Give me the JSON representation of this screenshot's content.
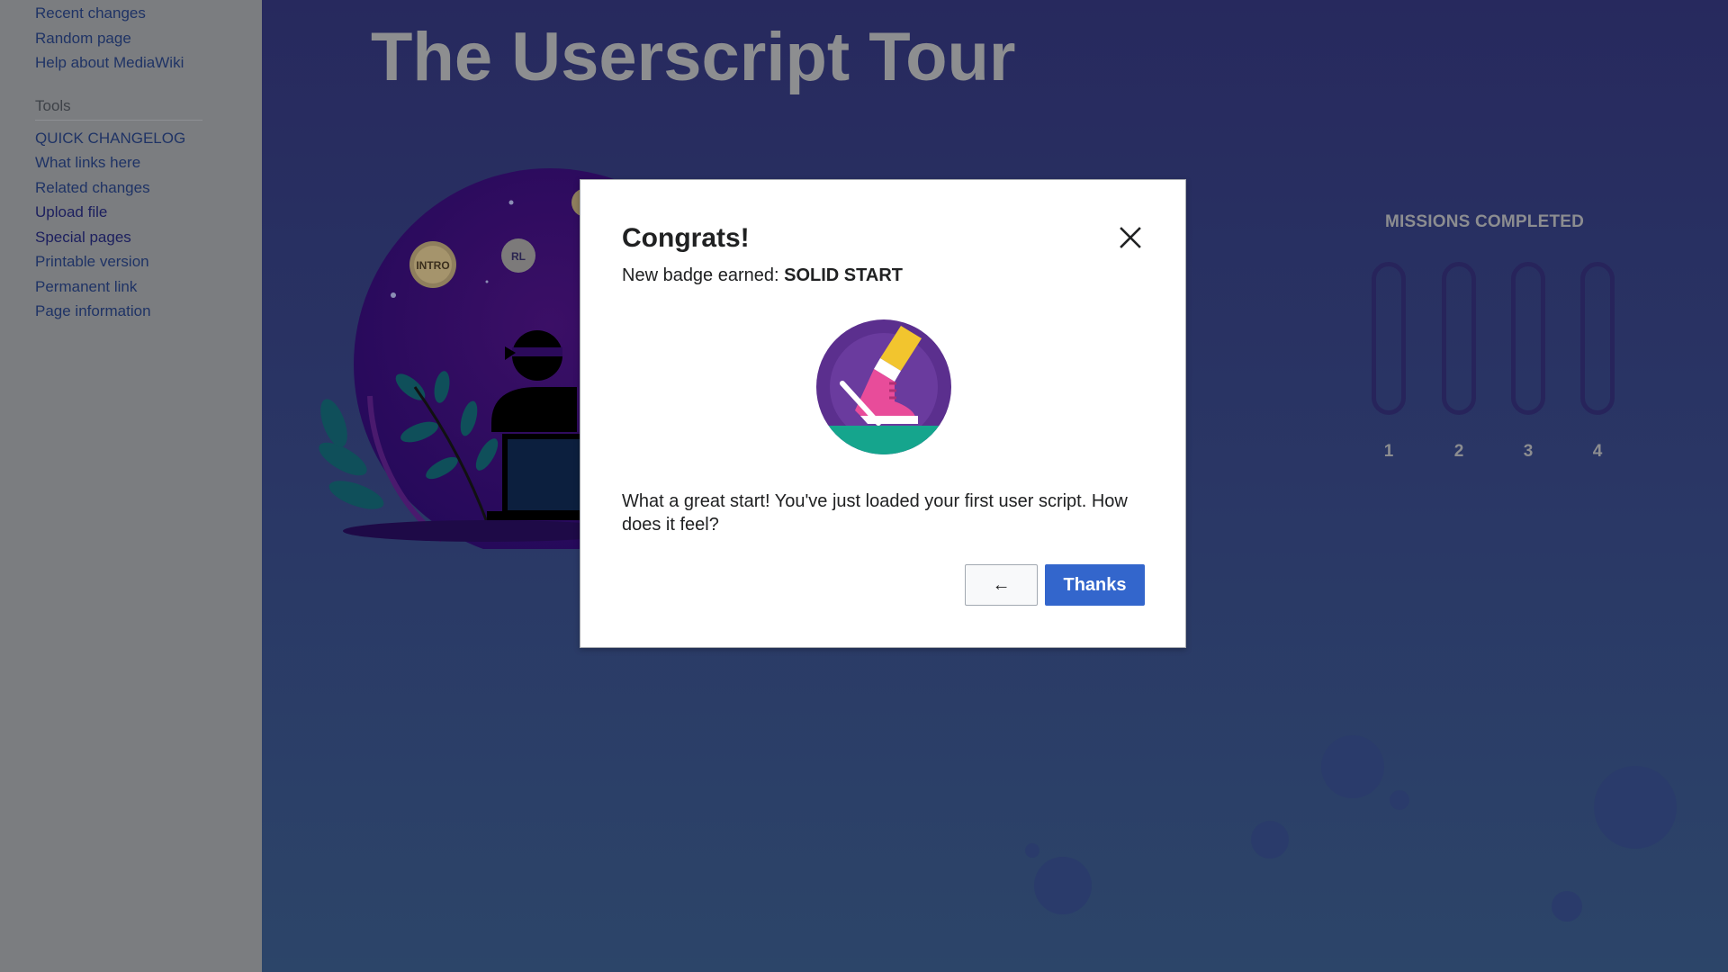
{
  "sidebar": {
    "nav_links": [
      "Recent changes",
      "Random page",
      "Help about MediaWiki"
    ],
    "tools_heading": "Tools",
    "tool_links": [
      "QUICK CHANGELOG",
      "What links here",
      "Related changes",
      "Upload file",
      "Special pages",
      "Printable version",
      "Permanent link",
      "Page information"
    ]
  },
  "main": {
    "title": "The Userscript Tour",
    "illustration_tokens": [
      "INTRO",
      "RL"
    ],
    "missions": {
      "heading": "MISSIONS COMPLETED",
      "slots": [
        "1",
        "2",
        "3",
        "4"
      ],
      "completed": 0
    }
  },
  "dialog": {
    "title": "Congrats!",
    "badge_prefix": "New badge earned: ",
    "badge_name": "SOLID START",
    "badge_icon": "sneaker-badge-icon",
    "message": "What a great start! You've just loaded your first user script. How does it feel?",
    "back_label": "←",
    "thanks_label": "Thanks",
    "close_icon": "close-icon"
  },
  "colors": {
    "primary_button": "#3366cc",
    "page_background": "#2a3566",
    "sidebar_background": "#7b7d80",
    "link": "#1f3365"
  }
}
